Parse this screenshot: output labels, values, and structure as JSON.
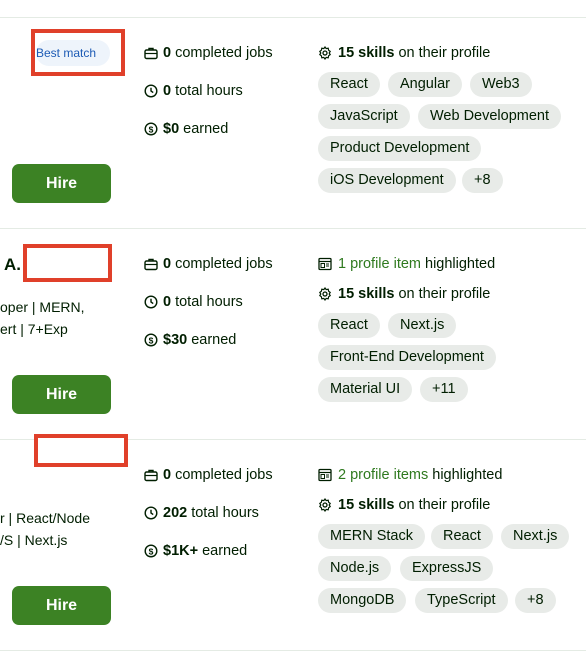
{
  "cards": [
    {
      "badge": "Best match",
      "button": "Hire",
      "stats": [
        {
          "icon": "briefcase-icon",
          "value": "0",
          "label": "completed jobs"
        },
        {
          "icon": "clock-icon",
          "value": "0",
          "label": "total hours"
        },
        {
          "icon": "dollar-icon",
          "value": "$0",
          "label": "earned"
        }
      ],
      "skills": {
        "count": "15 skills",
        "suffix": "on their profile"
      },
      "tags": [
        "React",
        "Angular",
        "Web3",
        "JavaScript",
        "Web Development",
        "Product Development",
        "iOS Development",
        "+8"
      ]
    },
    {
      "name_fragment": "A.",
      "title_lines": [
        "oper | MERN,",
        "ert | 7+Exp"
      ],
      "button": "Hire",
      "stats": [
        {
          "icon": "briefcase-icon",
          "value": "0",
          "label": "completed jobs"
        },
        {
          "icon": "clock-icon",
          "value": "0",
          "label": "total hours"
        },
        {
          "icon": "dollar-icon",
          "value": "$30",
          "label": "earned"
        }
      ],
      "highlight": {
        "link": "1 profile item",
        "suffix": "highlighted"
      },
      "skills": {
        "count": "15 skills",
        "suffix": "on their profile"
      },
      "tags": [
        "React",
        "Next.js",
        "Front-End Development",
        "Material UI",
        "+11"
      ]
    },
    {
      "title_lines": [
        "r | React/Node",
        "/S | Next.js"
      ],
      "button": "Hire",
      "stats": [
        {
          "icon": "briefcase-icon",
          "value": "0",
          "label": "completed jobs"
        },
        {
          "icon": "clock-icon",
          "value": "202",
          "label": "total hours"
        },
        {
          "icon": "dollar-icon",
          "value": "$1K+",
          "label": "earned"
        }
      ],
      "highlight": {
        "link": "2 profile items",
        "suffix": "highlighted"
      },
      "skills": {
        "count": "15 skills",
        "suffix": "on their profile"
      },
      "tags": [
        "MERN Stack",
        "React",
        "Next.js",
        "Node.js",
        "ExpressJS",
        "MongoDB",
        "TypeScript",
        "+8"
      ]
    }
  ],
  "colors": {
    "hire_green": "#3c8224",
    "highlight_green": "#2f7a1f",
    "redaction_red": "#e0402a",
    "badge_blue": "#1d5bb5"
  }
}
